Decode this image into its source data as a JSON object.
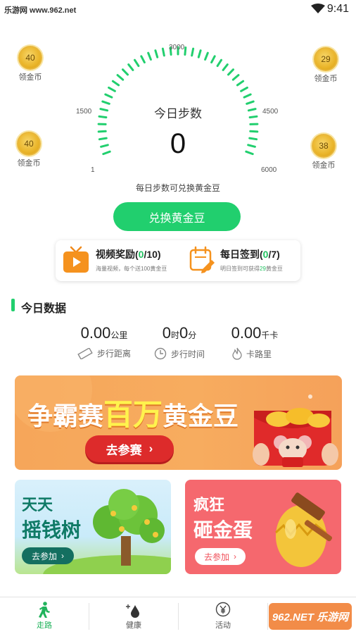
{
  "status_bar": {
    "site": "乐游网 www.962.net",
    "time": "9:41"
  },
  "coins": [
    {
      "value": "40",
      "label": "领金币"
    },
    {
      "value": "29",
      "label": "领金币"
    },
    {
      "value": "40",
      "label": "领金币"
    },
    {
      "value": "38",
      "label": "领金币"
    }
  ],
  "gauge": {
    "scale": [
      "1",
      "1500",
      "3000",
      "4500",
      "6000"
    ],
    "title": "今日步数",
    "value": "0",
    "hint": "每日步数可兑换黄金豆",
    "accent_color": "#21cf6e"
  },
  "exchange_button": "兑换黄金豆",
  "rewards": {
    "video": {
      "title": "视频奖励",
      "count": "0",
      "total": "/10)",
      "sub": "海量视频，每个送100黄金豆"
    },
    "signin": {
      "title": "每日签到",
      "count": "0",
      "total": "/7)",
      "sub_pre": "明日签到可获得",
      "sub_hl": "29",
      "sub_post": "黄金豆"
    }
  },
  "today": {
    "title": "今日数据",
    "distance": {
      "value": "0.00",
      "unit": "公里",
      "label": "步行距离"
    },
    "time": {
      "hours": "0",
      "hours_unit": "时",
      "minutes": "0",
      "minutes_unit": "分",
      "label": "步行时间"
    },
    "calories": {
      "value": "0.00",
      "unit": "千卡",
      "label": "卡路里"
    }
  },
  "banners": {
    "contest": {
      "t1": "争霸赛",
      "t2": "百万",
      "t3": "黄金豆",
      "button": "去参赛"
    },
    "money_tree": {
      "line1": "天天",
      "line2": "摇钱树",
      "button": "去参加"
    },
    "golden_egg": {
      "line1": "疯狂",
      "line2": "砸金蛋",
      "button": "去参加"
    }
  },
  "nav": [
    {
      "label": "走路",
      "active": true
    },
    {
      "label": "健康",
      "active": false
    },
    {
      "label": "活动",
      "active": false
    },
    {
      "label": "",
      "active": false
    }
  ],
  "watermark": "962.NET 乐游网"
}
